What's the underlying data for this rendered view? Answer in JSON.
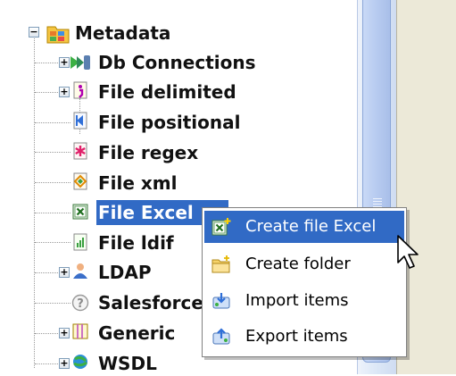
{
  "tree": {
    "root": {
      "label": "Metadata",
      "icon": "metadata-folder-icon",
      "expanded": true
    },
    "items": [
      {
        "label": "Db Connections",
        "icon": "db-connections-icon",
        "expandable": true
      },
      {
        "label": "File delimited",
        "icon": "file-delimited-icon",
        "expandable": true
      },
      {
        "label": "File positional",
        "icon": "file-positional-icon",
        "expandable": false
      },
      {
        "label": "File regex",
        "icon": "file-regex-icon",
        "expandable": false
      },
      {
        "label": "File xml",
        "icon": "file-xml-icon",
        "expandable": false
      },
      {
        "label": "File Excel",
        "icon": "file-excel-icon",
        "expandable": false,
        "selected": true
      },
      {
        "label": "File ldif",
        "icon": "file-ldif-icon",
        "expandable": false
      },
      {
        "label": "LDAP",
        "icon": "ldap-icon",
        "expandable": true
      },
      {
        "label": "Salesforce",
        "icon": "salesforce-icon",
        "expandable": false
      },
      {
        "label": "Generic",
        "icon": "generic-schema-icon",
        "expandable": true
      },
      {
        "label": "WSDL",
        "icon": "wsdl-icon",
        "expandable": true
      }
    ]
  },
  "context_menu": {
    "items": [
      {
        "label": "Create file Excel",
        "icon": "create-file-excel-icon",
        "highlighted": true
      },
      {
        "label": "Create folder",
        "icon": "create-folder-icon",
        "highlighted": false
      },
      {
        "label": "Import items",
        "icon": "import-items-icon",
        "highlighted": false
      },
      {
        "label": "Export items",
        "icon": "export-items-icon",
        "highlighted": false
      }
    ]
  },
  "colors": {
    "selection": "#316ac5",
    "panel_background": "#ece9d8",
    "scrollbar_thumb": "#b7cbf0"
  }
}
